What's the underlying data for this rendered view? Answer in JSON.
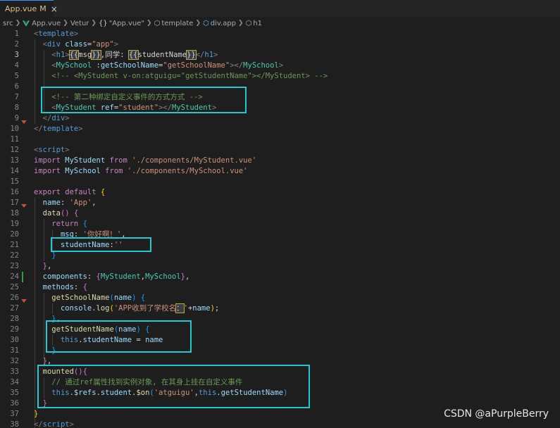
{
  "tab": {
    "filename": "App.vue",
    "status": "M",
    "close": "×"
  },
  "breadcrumb": [
    "src",
    "App.vue",
    "Vetur",
    "\"App.vue\"",
    "template",
    "div.app",
    "h1"
  ],
  "breadcrumb_icons": {
    "vue": "vue-logo-icon",
    "braces": "braces-icon",
    "element": "cube-icon"
  },
  "lines": [
    {
      "n": "1",
      "t": [
        [
          "k-brk",
          "<"
        ],
        [
          "k-tag",
          "template"
        ],
        [
          "k-brk",
          ">"
        ]
      ]
    },
    {
      "n": "2",
      "t": [
        [
          "k-txt",
          "  "
        ],
        [
          "k-brk",
          "<"
        ],
        [
          "k-tag",
          "div"
        ],
        [
          "k-txt",
          " "
        ],
        [
          "k-attr",
          "class"
        ],
        [
          "k-txt",
          "="
        ],
        [
          "k-str",
          "\"app\""
        ],
        [
          "k-brk",
          ">"
        ]
      ]
    },
    {
      "n": "3",
      "t": [
        [
          "k-txt",
          "    "
        ],
        [
          "k-brk",
          "<"
        ],
        [
          "k-tag",
          "h1"
        ],
        [
          "k-brk",
          ">"
        ],
        [
          "k-interp",
          "{{"
        ],
        [
          "k-txt",
          "msg"
        ],
        [
          "k-interp",
          "}}"
        ],
        [
          "k-txt",
          ",同学: "
        ],
        [
          "k-interp",
          "{{"
        ],
        [
          "k-txt",
          "studentName"
        ],
        [
          "k-interp",
          "}}"
        ],
        [
          "k-brk",
          "</"
        ],
        [
          "k-tag",
          "h1"
        ],
        [
          "k-brk",
          ">"
        ]
      ]
    },
    {
      "n": "4",
      "t": [
        [
          "k-txt",
          "    "
        ],
        [
          "k-brk",
          "<"
        ],
        [
          "k-comp",
          "MySchool"
        ],
        [
          "k-txt",
          " "
        ],
        [
          "k-attr",
          ":getSchoolName"
        ],
        [
          "k-txt",
          "="
        ],
        [
          "k-str",
          "\"getSchoolName\""
        ],
        [
          "k-brk",
          "></"
        ],
        [
          "k-comp",
          "MySchool"
        ],
        [
          "k-brk",
          ">"
        ]
      ]
    },
    {
      "n": "5",
      "t": [
        [
          "k-txt",
          "    "
        ],
        [
          "k-cmt",
          "<!-- <MyStudent v-on:atguigu=\"getStudentName\"></MyStudent> -->"
        ]
      ]
    },
    {
      "n": "6",
      "t": []
    },
    {
      "n": "7",
      "t": [
        [
          "k-txt",
          "    "
        ],
        [
          "k-cmt",
          "<!-- 第二种绑定自定义事件的方式方式 -->"
        ]
      ]
    },
    {
      "n": "8",
      "t": [
        [
          "k-txt",
          "    "
        ],
        [
          "k-brk",
          "<"
        ],
        [
          "k-comp",
          "MyStudent"
        ],
        [
          "k-txt",
          " "
        ],
        [
          "k-attr",
          "ref"
        ],
        [
          "k-txt",
          "="
        ],
        [
          "k-str",
          "\"student\""
        ],
        [
          "k-brk",
          "></"
        ],
        [
          "k-comp",
          "MyStudent"
        ],
        [
          "k-brk",
          ">"
        ]
      ]
    },
    {
      "n": "9",
      "t": [
        [
          "k-txt",
          "  "
        ],
        [
          "k-brk",
          "</"
        ],
        [
          "k-tag",
          "div"
        ],
        [
          "k-brk",
          ">"
        ]
      ]
    },
    {
      "n": "10",
      "t": [
        [
          "k-brk",
          "</"
        ],
        [
          "k-tag",
          "template"
        ],
        [
          "k-brk",
          ">"
        ]
      ]
    },
    {
      "n": "11",
      "t": []
    },
    {
      "n": "12",
      "t": [
        [
          "k-brk",
          "<"
        ],
        [
          "k-tag",
          "script"
        ],
        [
          "k-brk",
          ">"
        ]
      ]
    },
    {
      "n": "13",
      "t": [
        [
          "k-kw",
          "import"
        ],
        [
          "k-txt",
          " "
        ],
        [
          "k-var",
          "MyStudent"
        ],
        [
          "k-txt",
          " "
        ],
        [
          "k-kw",
          "from"
        ],
        [
          "k-txt",
          " "
        ],
        [
          "k-str",
          "'./components/MyStudent.vue'"
        ]
      ]
    },
    {
      "n": "14",
      "t": [
        [
          "k-kw",
          "import"
        ],
        [
          "k-txt",
          " "
        ],
        [
          "k-var",
          "MySchool"
        ],
        [
          "k-txt",
          " "
        ],
        [
          "k-kw",
          "from"
        ],
        [
          "k-txt",
          " "
        ],
        [
          "k-str",
          "'./components/MySchool.vue'"
        ]
      ]
    },
    {
      "n": "15",
      "t": []
    },
    {
      "n": "16",
      "t": [
        [
          "k-kw",
          "export"
        ],
        [
          "k-txt",
          " "
        ],
        [
          "k-kw",
          "default"
        ],
        [
          "k-txt",
          " "
        ],
        [
          "k-brace",
          "{"
        ]
      ]
    },
    {
      "n": "17",
      "t": [
        [
          "k-txt",
          "  "
        ],
        [
          "k-var",
          "name"
        ],
        [
          "k-txt",
          ": "
        ],
        [
          "k-str",
          "'App'"
        ],
        [
          "k-txt",
          ","
        ]
      ]
    },
    {
      "n": "18",
      "t": [
        [
          "k-txt",
          "  "
        ],
        [
          "k-fn",
          "data"
        ],
        [
          "k-brace2",
          "()"
        ],
        [
          "k-txt",
          " "
        ],
        [
          "k-brace2",
          "{"
        ]
      ]
    },
    {
      "n": "19",
      "t": [
        [
          "k-txt",
          "    "
        ],
        [
          "k-kw",
          "return"
        ],
        [
          "k-txt",
          " "
        ],
        [
          "k-brace3",
          "{"
        ]
      ]
    },
    {
      "n": "20",
      "t": [
        [
          "k-txt",
          "      "
        ],
        [
          "k-var",
          "msg"
        ],
        [
          "k-txt",
          ": "
        ],
        [
          "k-str",
          "'你好啊！'"
        ],
        [
          "k-txt",
          ","
        ]
      ]
    },
    {
      "n": "21",
      "t": [
        [
          "k-txt",
          "      "
        ],
        [
          "k-var",
          "studentName"
        ],
        [
          "k-txt",
          ":"
        ],
        [
          "k-str",
          "''"
        ]
      ]
    },
    {
      "n": "22",
      "t": [
        [
          "k-txt",
          "    "
        ],
        [
          "k-brace3",
          "}"
        ]
      ]
    },
    {
      "n": "23",
      "t": [
        [
          "k-txt",
          "  "
        ],
        [
          "k-brace2",
          "}"
        ],
        [
          "k-txt",
          ","
        ]
      ]
    },
    {
      "n": "24",
      "t": [
        [
          "k-txt",
          "  "
        ],
        [
          "k-var",
          "components"
        ],
        [
          "k-txt",
          ": "
        ],
        [
          "k-brace2",
          "{"
        ],
        [
          "k-comp",
          "MyStudent"
        ],
        [
          "k-txt",
          ","
        ],
        [
          "k-comp",
          "MySchool"
        ],
        [
          "k-brace2",
          "}"
        ],
        [
          "k-txt",
          ","
        ]
      ]
    },
    {
      "n": "25",
      "t": [
        [
          "k-txt",
          "  "
        ],
        [
          "k-var",
          "methods"
        ],
        [
          "k-txt",
          ": "
        ],
        [
          "k-brace2",
          "{"
        ]
      ]
    },
    {
      "n": "26",
      "t": [
        [
          "k-txt",
          "    "
        ],
        [
          "k-fn",
          "getSchoolName"
        ],
        [
          "k-brace3",
          "("
        ],
        [
          "k-var",
          "name"
        ],
        [
          "k-brace3",
          ")"
        ],
        [
          "k-txt",
          " "
        ],
        [
          "k-brace3",
          "{"
        ]
      ]
    },
    {
      "n": "27",
      "t": [
        [
          "k-txt",
          "      "
        ],
        [
          "k-var",
          "console"
        ],
        [
          "k-txt",
          "."
        ],
        [
          "k-fn",
          "log"
        ],
        [
          "k-brace",
          "("
        ],
        [
          "k-str",
          "'APP收到了学校名"
        ],
        [
          "k-interp",
          "："
        ],
        [
          "k-str",
          "'"
        ],
        [
          "k-txt",
          "+"
        ],
        [
          "k-var",
          "name"
        ],
        [
          "k-brace",
          ")"
        ],
        [
          "k-txt",
          ";"
        ]
      ]
    },
    {
      "n": "28",
      "t": [
        [
          "k-txt",
          "    "
        ],
        [
          "k-brace3",
          "}"
        ],
        [
          "k-txt",
          ","
        ]
      ]
    },
    {
      "n": "29",
      "t": [
        [
          "k-txt",
          "    "
        ],
        [
          "k-fn",
          "getStudentName"
        ],
        [
          "k-brace3",
          "("
        ],
        [
          "k-var",
          "name"
        ],
        [
          "k-brace3",
          ")"
        ],
        [
          "k-txt",
          " "
        ],
        [
          "k-brace3",
          "{"
        ]
      ]
    },
    {
      "n": "30",
      "t": [
        [
          "k-txt",
          "      "
        ],
        [
          "k-kw2",
          "this"
        ],
        [
          "k-txt",
          "."
        ],
        [
          "k-var",
          "studentName"
        ],
        [
          "k-txt",
          " = "
        ],
        [
          "k-var",
          "name"
        ]
      ]
    },
    {
      "n": "31",
      "t": [
        [
          "k-txt",
          "    "
        ],
        [
          "k-brace3",
          "}"
        ]
      ]
    },
    {
      "n": "32",
      "t": [
        [
          "k-txt",
          "  "
        ],
        [
          "k-brace2",
          "}"
        ],
        [
          "k-txt",
          ","
        ]
      ]
    },
    {
      "n": "33",
      "t": [
        [
          "k-txt",
          "  "
        ],
        [
          "k-fn",
          "mounted"
        ],
        [
          "k-brace2",
          "()"
        ],
        [
          "k-brace2",
          "{"
        ]
      ]
    },
    {
      "n": "34",
      "t": [
        [
          "k-txt",
          "    "
        ],
        [
          "k-cmt",
          "// 通过ref属性找到实例对象, 在其身上挂在自定义事件"
        ]
      ]
    },
    {
      "n": "35",
      "t": [
        [
          "k-txt",
          "    "
        ],
        [
          "k-kw2",
          "this"
        ],
        [
          "k-txt",
          "."
        ],
        [
          "k-var",
          "$refs"
        ],
        [
          "k-txt",
          "."
        ],
        [
          "k-var",
          "student"
        ],
        [
          "k-txt",
          "."
        ],
        [
          "k-fn",
          "$on"
        ],
        [
          "k-brace3",
          "("
        ],
        [
          "k-str",
          "'atguigu'"
        ],
        [
          "k-txt",
          ","
        ],
        [
          "k-kw2",
          "this"
        ],
        [
          "k-txt",
          "."
        ],
        [
          "k-var",
          "getStudentName"
        ],
        [
          "k-brace3",
          ")"
        ]
      ]
    },
    {
      "n": "36",
      "t": [
        [
          "k-txt",
          "  "
        ],
        [
          "k-brace2",
          "}"
        ]
      ]
    },
    {
      "n": "37",
      "t": [
        [
          "k-brace",
          "}"
        ]
      ]
    },
    {
      "n": "38",
      "t": [
        [
          "k-brk",
          "</"
        ],
        [
          "k-tag",
          "script"
        ],
        [
          "k-brk",
          ">"
        ]
      ]
    }
  ],
  "current_line": "3",
  "watermark": "CSDN @aPurpleBerry",
  "colors": {
    "highlight_box": "#23c8d2",
    "tab_accent": "#3794ff",
    "modified_tab_text": "#e2c08d"
  }
}
